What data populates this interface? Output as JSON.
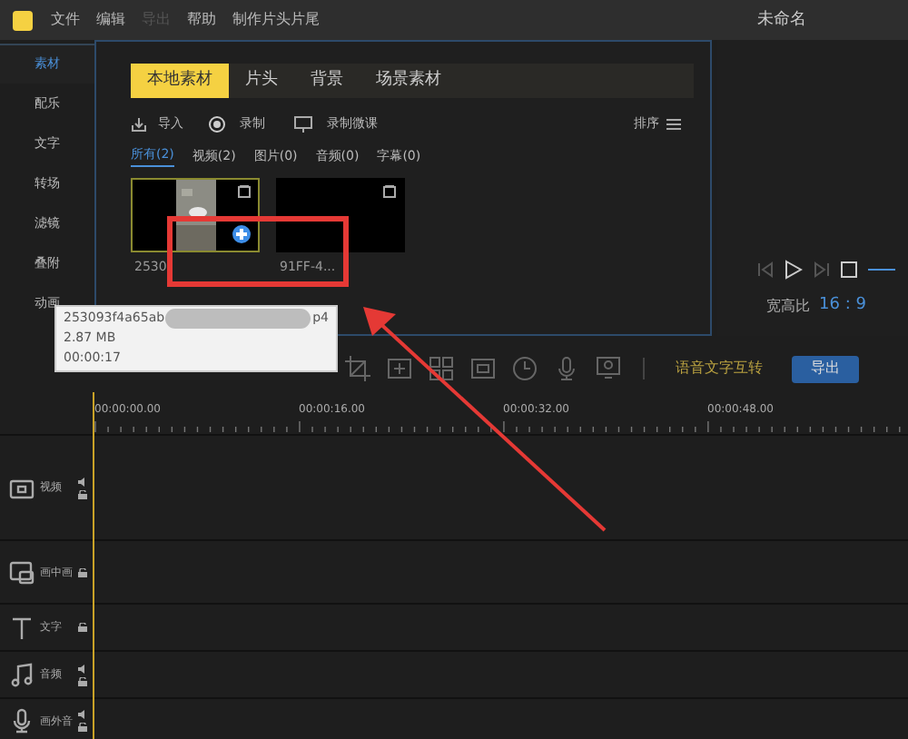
{
  "menu": [
    "文件",
    "编辑",
    "导出",
    "帮助",
    "制作片头片尾"
  ],
  "menu_disabled": [
    false,
    false,
    true,
    false,
    false
  ],
  "window": {
    "title": "未命名"
  },
  "sidebar": [
    {
      "label": "素材",
      "selected": true
    },
    {
      "label": "配乐",
      "selected": false
    },
    {
      "label": "文字",
      "selected": false
    },
    {
      "label": "转场",
      "selected": false
    },
    {
      "label": "滤镜",
      "selected": false
    },
    {
      "label": "叠附",
      "selected": false
    },
    {
      "label": "动画",
      "selected": false
    }
  ],
  "tabs": [
    {
      "label": "本地素材",
      "selected": true
    },
    {
      "label": "片头",
      "selected": false
    },
    {
      "label": "背景",
      "selected": false
    },
    {
      "label": "场景素材",
      "selected": false
    }
  ],
  "actions": [
    "导入",
    "录制",
    "录制微课"
  ],
  "sort": "排序",
  "filters": [
    {
      "label": "所有(2)",
      "selected": true
    },
    {
      "label": "视频(2)",
      "selected": false
    },
    {
      "label": "图片(0)",
      "selected": false
    },
    {
      "label": "音频(0)",
      "selected": false
    },
    {
      "label": "字幕(0)",
      "selected": false
    }
  ],
  "clips": [
    {
      "name": "2530",
      "selected": true,
      "kind": "picture"
    },
    {
      "name": "91FF-4...",
      "selected": false,
      "kind": "black"
    }
  ],
  "tooltip": {
    "name_start": "253093f4a65ab",
    "name_end": "p4",
    "size": "2.87 MB",
    "duration": "00:00:17"
  },
  "preview": {
    "aspect_label": "宽高比",
    "aspect_value": "16 : 9"
  },
  "speech_button": "语音文字互转",
  "export_button": "导出",
  "ruler": [
    "00:00:00.00",
    "00:00:16.00",
    "00:00:32.00",
    "00:00:48.00"
  ],
  "tracks": [
    {
      "label": "视频",
      "kind": "video",
      "sound": true
    },
    {
      "label": "画中画",
      "kind": "pip",
      "sound": false
    },
    {
      "label": "文字",
      "kind": "text",
      "sound": false
    },
    {
      "label": "音频",
      "kind": "audio",
      "sound": true
    },
    {
      "label": "画外音",
      "kind": "voice",
      "sound": true
    }
  ]
}
